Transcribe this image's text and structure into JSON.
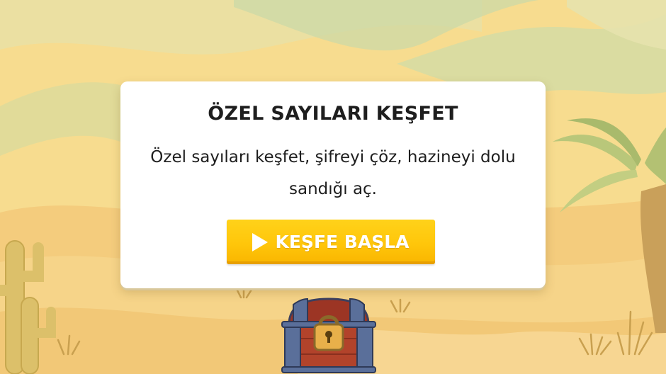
{
  "intro_card": {
    "title": "ÖZEL SAYILARI KEŞFET",
    "description": "Özel sayıları keşfet, şifreyi çöz, hazineyi dolu sandığı aç.",
    "start_button_label": "KEŞFE BAŞLA",
    "start_button_icon": "play-icon"
  },
  "scene": {
    "background_theme": "desert",
    "decorations": [
      "cactus",
      "palm-tree",
      "treasure-chest",
      "grass-tufts"
    ]
  },
  "colors": {
    "sky": "#f7dc8f",
    "sand": "#f6d489",
    "card": "#ffffff",
    "button": "#ffc60a",
    "button_text": "#ffffff",
    "chest_wood": "#b2432b",
    "chest_metal": "#5a6f9a",
    "lock": "#e8b04a"
  }
}
